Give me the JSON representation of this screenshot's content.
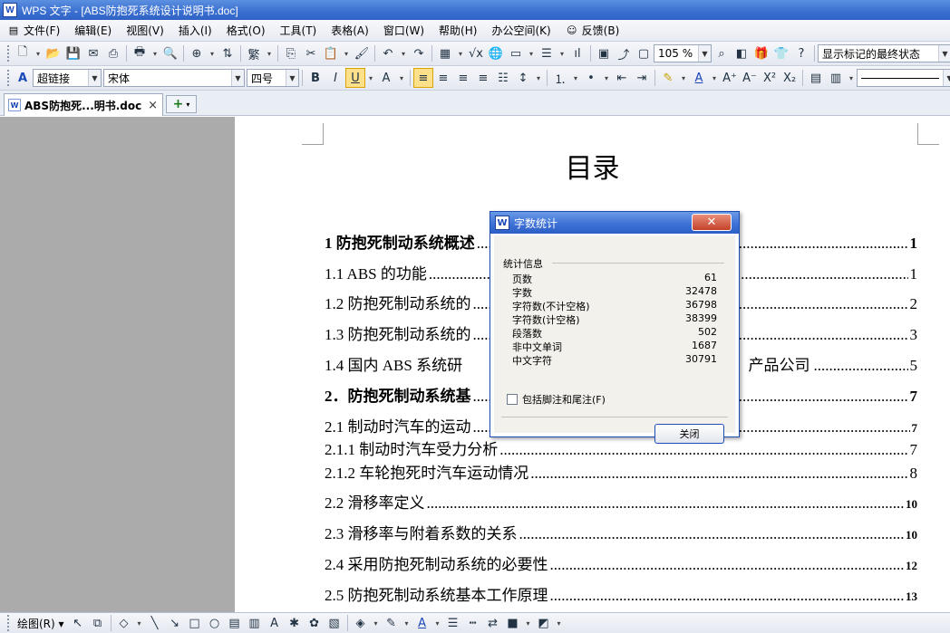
{
  "title_bar": {
    "logo": "W",
    "title": "WPS 文字 - [ABS防抱死系统设计说明书.doc]"
  },
  "menu": [
    {
      "label": "文件(F)",
      "icon": "doc-icon"
    },
    {
      "label": "编辑(E)"
    },
    {
      "label": "视图(V)"
    },
    {
      "label": "插入(I)"
    },
    {
      "label": "格式(O)"
    },
    {
      "label": "工具(T)"
    },
    {
      "label": "表格(A)"
    },
    {
      "label": "窗口(W)"
    },
    {
      "label": "帮助(H)"
    },
    {
      "label": "办公空间(K)"
    },
    {
      "label": "反馈(B)",
      "icon": "user-icon"
    }
  ],
  "toolbar1": {
    "zoom": "105 %",
    "track_state": "显示标记的最终状态"
  },
  "toolbar2": {
    "style": "超链接",
    "font": "宋体",
    "size": "四号"
  },
  "tab": {
    "label": "ABS防抱死...明书.doc",
    "close": "×",
    "new_icon": "+"
  },
  "document": {
    "title": "目录",
    "toc": [
      {
        "text": "1  防抱死制动系统概述",
        "page": "1",
        "bold": true
      },
      {
        "text": "1.1 ABS 的功能",
        "page": "1"
      },
      {
        "text": "1.2  防抱死制动系统的",
        "page": "2"
      },
      {
        "text": "1.3  防抱死制动系统的",
        "page": "3"
      },
      {
        "text": "1.4  国内 ABS 系统研",
        "mid": "产品公司",
        "page": "5"
      },
      {
        "text": "2．防抱死制动系统基",
        "page": "7",
        "bold": true
      },
      {
        "text": "2.1  制动时汽车的运动",
        "page": "7",
        "small": true
      },
      {
        "text": "2.1.1  制动时汽车受力分析",
        "page": "7"
      },
      {
        "text": "2.1.2  车轮抱死时汽车运动情况",
        "page": "8"
      },
      {
        "text": "2.2 滑移率定义",
        "page": "10",
        "small": true
      },
      {
        "text": "2.3  滑移率与附着系数的关系",
        "page": "10",
        "small": true
      },
      {
        "text": "2.4  采用防抱死制动系统的必要性",
        "page": "12",
        "small": true
      },
      {
        "text": "2.5  防抱死制动系统基本工作原理",
        "page": "13",
        "small": true
      }
    ]
  },
  "dialog": {
    "title": "字数统计",
    "group": "统计信息",
    "rows": [
      {
        "label": "页数",
        "value": "61"
      },
      {
        "label": "字数",
        "value": "32478"
      },
      {
        "label": "字符数(不计空格)",
        "value": "36798"
      },
      {
        "label": "字符数(计空格)",
        "value": "38399"
      },
      {
        "label": "段落数",
        "value": "502"
      },
      {
        "label": "非中文单词",
        "value": "1687"
      },
      {
        "label": "中文字符",
        "value": "30791"
      }
    ],
    "checkbox": "包括脚注和尾注(F)",
    "close_button": "关闭",
    "close_x": "✕"
  },
  "draw_toolbar": {
    "label": "绘图(R)"
  }
}
